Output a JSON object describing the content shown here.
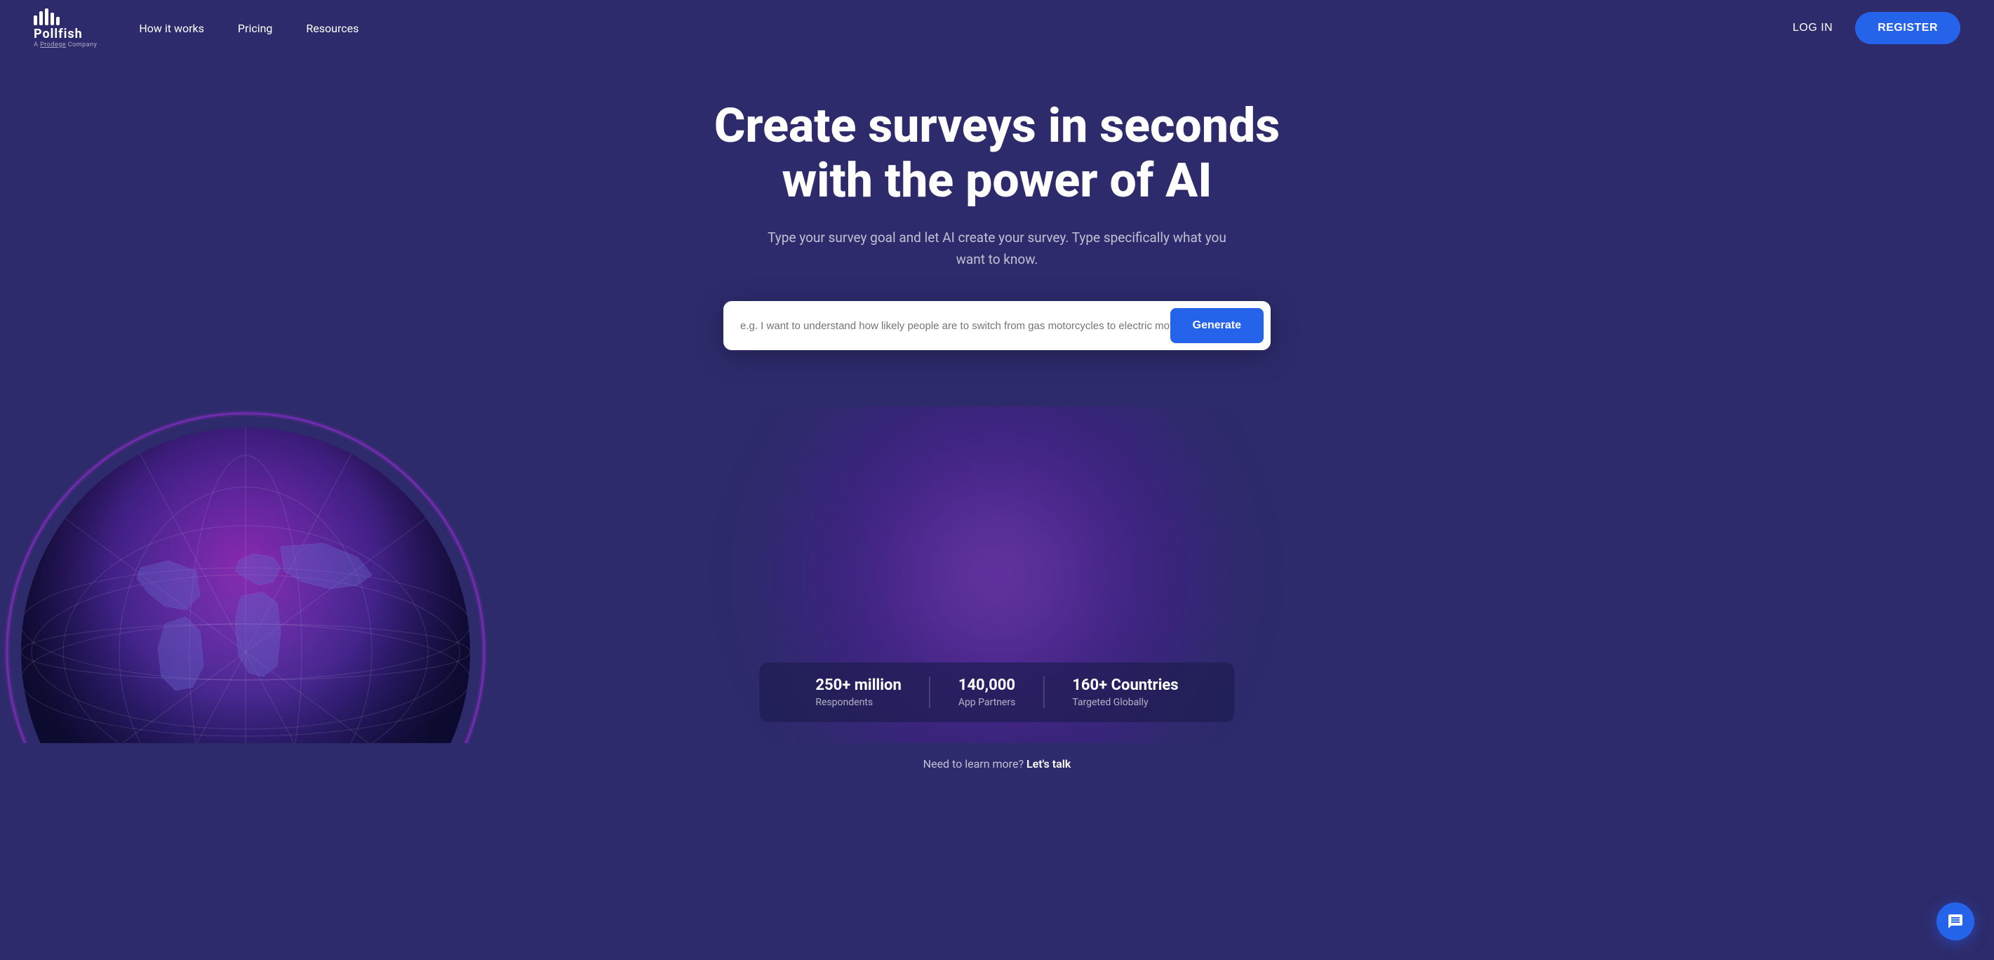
{
  "nav": {
    "logo_text": "Pollfish",
    "company_label": "A Prodege Company",
    "links": [
      {
        "label": "How it works",
        "id": "how-it-works"
      },
      {
        "label": "Pricing",
        "id": "pricing"
      },
      {
        "label": "Resources",
        "id": "resources"
      }
    ],
    "login_label": "LOG IN",
    "register_label": "REGISTER"
  },
  "hero": {
    "title": "Create surveys in seconds with the power of AI",
    "subtitle": "Type your survey goal and let AI create your survey. Type specifically what you want to know.",
    "input_placeholder": "e.g. I want to understand how likely people are to switch from gas motorcycles to electric motorcycles.",
    "generate_label": "Generate"
  },
  "stats": [
    {
      "number": "250+ million",
      "label": "Respondents"
    },
    {
      "number": "140,000",
      "label": "App Partners"
    },
    {
      "number": "160+ Countries",
      "label": "Targeted Globally"
    }
  ],
  "bottom_cta": {
    "text": "Need to learn more?",
    "link_text": "Let's talk"
  },
  "colors": {
    "bg": "#2d2b6b",
    "blue": "#2563eb",
    "globe_glow": "#9333ea"
  }
}
